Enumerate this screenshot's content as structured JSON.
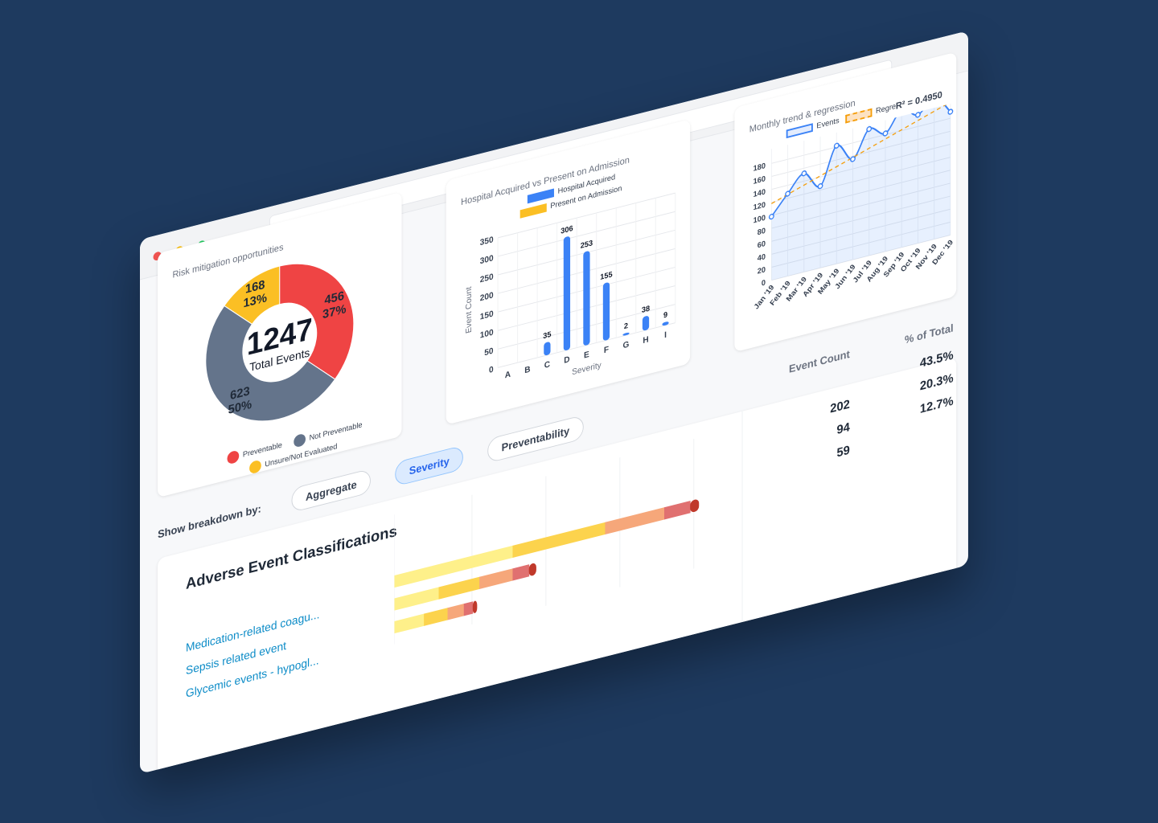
{
  "window": {
    "traffic_lights": [
      "close",
      "minimize",
      "maximize"
    ]
  },
  "cards": {
    "donut": {
      "title": "",
      "subtitle": "Risk mitigation opportunities",
      "center_value": "1247",
      "center_label": "Total Events",
      "legend": [
        {
          "label": "Preventable",
          "color": "#ef4444"
        },
        {
          "label": "Not Preventable",
          "color": "#64748b"
        },
        {
          "label": "Unsure/Not Evaluated",
          "color": "#fbbf24"
        }
      ]
    },
    "bar": {
      "title": "",
      "subtitle": "Hospital Acquired vs Present on Admission",
      "legend": [
        {
          "label": "Hospital Acquired",
          "color": "#3b82f6"
        },
        {
          "label": "Present on Admission",
          "color": "#fbbf24"
        }
      ]
    },
    "line": {
      "title": "",
      "subtitle": "Monthly trend & regression",
      "legend": [
        {
          "label": "Events",
          "color": "#3b82f6"
        },
        {
          "label": "Regre",
          "color": "#f59e0b"
        }
      ],
      "r_squared": "R² = 0.4950"
    }
  },
  "chart_data": [
    {
      "type": "pie",
      "categories": [
        "Preventable",
        "Not Preventable",
        "Unsure/Not Evaluated"
      ],
      "values": [
        456,
        623,
        168
      ],
      "percent_labels": [
        "37%",
        "50%",
        "13%"
      ],
      "colors": [
        "#ef4444",
        "#64748b",
        "#fbbf24"
      ],
      "total": 1247,
      "legend_position": "bottom"
    },
    {
      "type": "bar",
      "categories": [
        "A",
        "B",
        "C",
        "D",
        "E",
        "F",
        "G",
        "H",
        "I"
      ],
      "series": [
        {
          "name": "Hospital Acquired",
          "values": [
            0,
            0,
            35,
            306,
            253,
            155,
            2,
            38,
            9
          ]
        }
      ],
      "xlabel": "Severity",
      "ylabel": "Event Count",
      "ylim": [
        0,
        350
      ],
      "yticks": [
        0,
        50,
        100,
        150,
        200,
        250,
        300,
        350
      ],
      "grid": true,
      "legend_position": "top"
    },
    {
      "type": "line",
      "x": [
        "Jan '19",
        "Feb '19",
        "Mar '19",
        "Apr '19",
        "May '19",
        "Jun '19",
        "Jul '19",
        "Aug '19",
        "Sep '19",
        "Oct '19",
        "Nov '19",
        "Dec '19"
      ],
      "series": [
        {
          "name": "Events",
          "values": [
            98,
            127,
            152,
            126,
            182,
            155,
            195,
            182,
            212,
            198,
            219,
            190
          ]
        }
      ],
      "regression": {
        "label": "R² = 0.4950",
        "start": 118,
        "end": 205
      },
      "ylim": [
        0,
        180
      ],
      "yticks": [
        0,
        20,
        40,
        60,
        80,
        100,
        120,
        140,
        160,
        180
      ],
      "grid": true,
      "legend_position": "top"
    }
  ],
  "breakdown": {
    "label": "Show breakdown by:",
    "options": [
      {
        "label": "Aggregate",
        "active": false
      },
      {
        "label": "Severity",
        "active": true
      },
      {
        "label": "Preventability",
        "active": false
      }
    ]
  },
  "classifications": {
    "title": "Adverse Event Classifications",
    "items": [
      "Medication-related coagu...",
      "Sepsis related event",
      "Glycemic events - hypogl..."
    ],
    "bars": [
      {
        "values": [
          160,
          125,
          80,
          35,
          12
        ],
        "colors": [
          "#fef08a",
          "#fcd34d",
          "#f6a77a",
          "#e07070",
          "#c0392b"
        ]
      },
      {
        "values": [
          60,
          55,
          45,
          22,
          10
        ],
        "colors": [
          "#fef08a",
          "#fcd34d",
          "#f6a77a",
          "#e07070",
          "#c0392b"
        ]
      },
      {
        "values": [
          40,
          32,
          22,
          12,
          6
        ],
        "colors": [
          "#fef08a",
          "#fcd34d",
          "#f6a77a",
          "#e07070",
          "#c0392b"
        ]
      }
    ],
    "table": {
      "headers": [
        "Event Count",
        "% of Total"
      ],
      "rows": [
        {
          "count": "",
          "percent": "43.5%"
        },
        {
          "count": "202",
          "percent": "20.3%"
        },
        {
          "count": "94",
          "percent": "12.7%"
        },
        {
          "count": "59",
          "percent": ""
        }
      ]
    }
  }
}
